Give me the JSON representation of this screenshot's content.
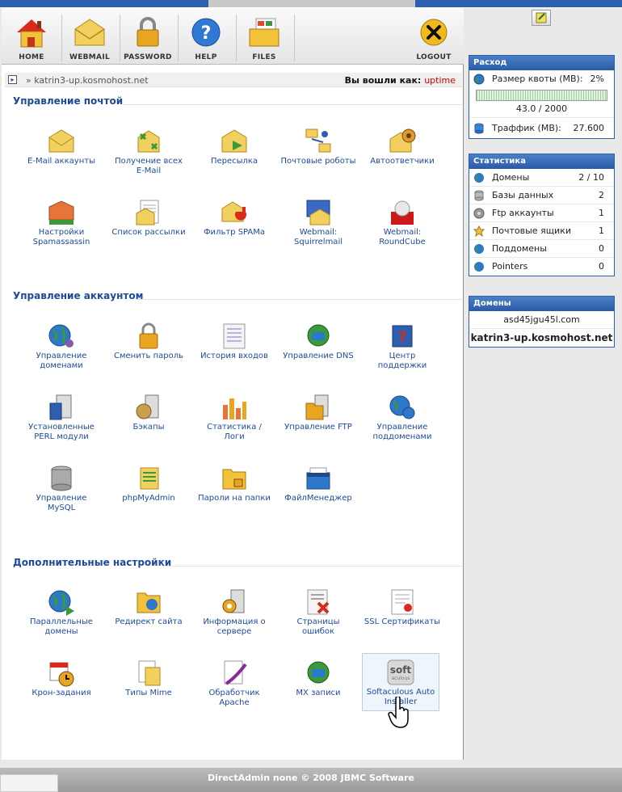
{
  "nav": {
    "home": "HOME",
    "webmail": "WEBMAIL",
    "password": "PASSWORD",
    "help": "HELP",
    "files": "FILES",
    "logout": "LOGOUT"
  },
  "breadcrumb": {
    "path": "» katrin3-up.kosmohost.net",
    "login_label": "Вы вошли как:",
    "login_user": "uptime"
  },
  "sections": {
    "mail": "Управление почтой",
    "account": "Управление аккаунтом",
    "extra": "Дополнительные настройки"
  },
  "mail_items": [
    "E-Mail аккаунты",
    "Получение всех E-Mail",
    "Пересылка",
    "Почтовые роботы",
    "Автоответчики",
    "Настройки Spamassassin",
    "Список рассылки",
    "Фильтр SPAMа",
    "Webmail: Squirrelmail",
    "Webmail: RoundCube"
  ],
  "account_items": [
    "Управление доменами",
    "Сменить пароль",
    "История входов",
    "Управление DNS",
    "Центр поддержки",
    "Установленные PERL модули",
    "Бэкапы",
    "Статистика / Логи",
    "Управление FTP",
    "Управление поддоменами",
    "Управление MySQL",
    "phpMyAdmin",
    "Пароли на папки",
    "ФайлМенеджер"
  ],
  "extra_items": [
    "Параллельные домены",
    "Редирект сайта",
    "Информация о сервере",
    "Страницы ошибок",
    "SSL Сертификаты",
    "Крон-задания",
    "Типы Mime",
    "Обработчик Apache",
    "MX записи",
    "Softaculous Auto Installer"
  ],
  "usage": {
    "title": "Расход",
    "quota_label": "Размер квоты (MB):",
    "quota_value": "2%",
    "quota_fraction": 0.02,
    "quota_text": "43.0 / 2000",
    "traffic_label": "Траффик (MB):",
    "traffic_value": "27.600"
  },
  "stats": {
    "title": "Статистика",
    "rows": [
      {
        "label": "Домены",
        "value": "2 / 10"
      },
      {
        "label": "Базы данных",
        "value": "2"
      },
      {
        "label": "Ftp аккаунты",
        "value": "1"
      },
      {
        "label": "Почтовые ящики",
        "value": "1"
      },
      {
        "label": "Поддомены",
        "value": "0"
      },
      {
        "label": "Pointers",
        "value": "0"
      }
    ]
  },
  "domains": {
    "title": "Домены",
    "list": [
      "asd45jgu45l.com",
      "katrin3-up.kosmohost.net"
    ]
  },
  "icons": {
    "soft_logo": "soft",
    "soft_sub": "aculous"
  },
  "footer": {
    "text": "DirectAdmin none © 2008 JBMC Software"
  }
}
